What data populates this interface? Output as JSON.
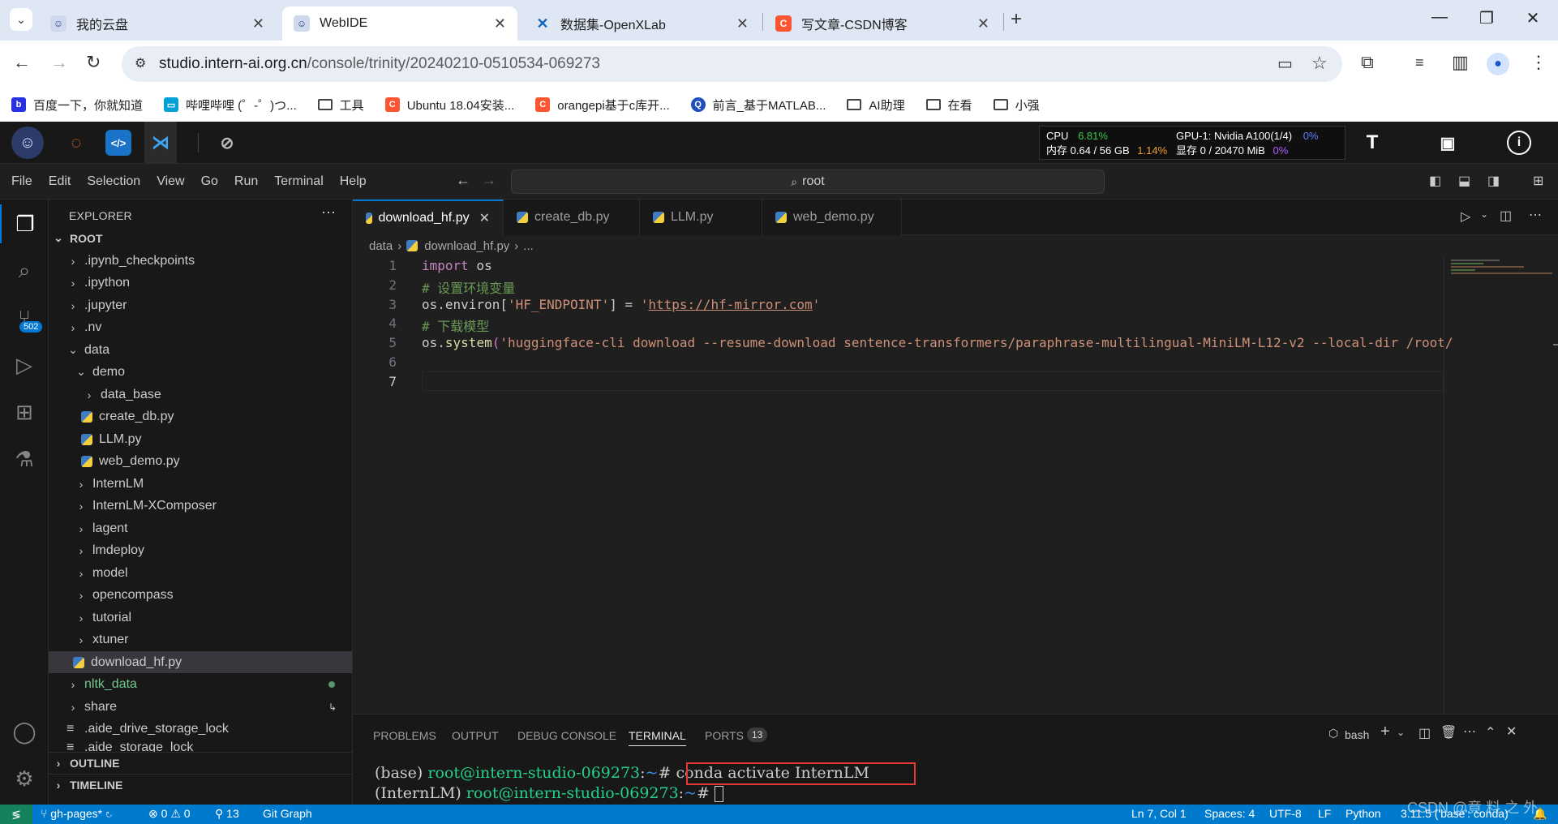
{
  "browser": {
    "tabs": [
      {
        "title": "我的云盘",
        "active": false
      },
      {
        "title": "WebIDE",
        "active": true
      },
      {
        "title": "数据集-OpenXLab",
        "active": false
      },
      {
        "title": "写文章-CSDN博客",
        "active": false
      }
    ],
    "url_host": "studio.intern-ai.org.cn",
    "url_path": "/console/trinity/20240210-0510534-069273",
    "bookmarks": [
      "百度一下，你就知道",
      "哔哩哔哩 (゜-゜)つ...",
      "工具",
      "Ubuntu 18.04安装...",
      "orangepi基于c库开...",
      "前言_基于MATLAB...",
      "AI助理",
      "在看",
      "小强"
    ]
  },
  "studio": {
    "cpu_label": "CPU",
    "cpu_value": "6.81%",
    "mem_label": "内存",
    "mem_value": "0.64 / 56 GB",
    "mem_percent": "1.14%",
    "gpu_label": "GPU-1: Nvidia A100(1/4)",
    "gpu_percent": "0%",
    "vram_label": "显存",
    "vram_value": "0 / 20470 MiB",
    "vram_percent": "0%"
  },
  "menu": [
    "File",
    "Edit",
    "Selection",
    "View",
    "Go",
    "Run",
    "Terminal",
    "Help"
  ],
  "command_center": "root",
  "scm_badge": "502",
  "explorer": {
    "header": "EXPLORER",
    "root": "ROOT",
    "items": [
      ".ipynb_checkpoints",
      ".ipython",
      ".jupyter",
      ".nv",
      "data",
      "demo",
      "data_base",
      "create_db.py",
      "LLM.py",
      "web_demo.py",
      "InternLM",
      "InternLM-XComposer",
      "lagent",
      "lmdeploy",
      "model",
      "opencompass",
      "tutorial",
      "xtuner",
      "download_hf.py",
      "nltk_data",
      "share",
      ".aide_drive_storage_lock",
      ".aide_storage_lock"
    ],
    "outline": "OUTLINE",
    "timeline": "TIMELINE"
  },
  "editor": {
    "tabs": [
      "download_hf.py",
      "create_db.py",
      "LLM.py",
      "web_demo.py"
    ],
    "breadcrumb": [
      "data",
      "download_hf.py",
      "..."
    ],
    "line_numbers": [
      "1",
      "2",
      "3",
      "4",
      "5",
      "6",
      "7"
    ],
    "code": {
      "l1_kw": "import",
      "l1_rest": " os",
      "l2": "# 设置环境变量",
      "l3_a": "os.environ[",
      "l3_key": "'HF_ENDPOINT'",
      "l3_b": "] = ",
      "l3_q1": "'",
      "l3_url": "https://hf-mirror.com",
      "l3_q2": "'",
      "l4": "# 下载模型",
      "l5_a": "os.",
      "l5_fn": "system",
      "l5_p": "(",
      "l5_str": "'huggingface-cli download --resume-download sentence-transformers/paraphrase-multilingual-MiniLM-L12-v2 --local-dir /root/"
    }
  },
  "panel": {
    "tabs": [
      "PROBLEMS",
      "OUTPUT",
      "DEBUG CONSOLE",
      "TERMINAL",
      "PORTS"
    ],
    "ports_count": "13",
    "shell": "bash",
    "term_l1_env": "(base) ",
    "term_l1_user": "root@intern-studio-069273",
    "term_l1_colon": ":",
    "term_l1_path": "~",
    "term_l1_hash": "# ",
    "term_l1_cmd": "conda activate InternLM",
    "term_l2_env": "(InternLM) ",
    "term_l2_user": "root@intern-studio-069273",
    "term_l2_colon": ":",
    "term_l2_path": "~",
    "term_l2_hash": "# "
  },
  "status": {
    "branch": "gh-pages*",
    "errors": "0",
    "warnings": "0",
    "ports": "13",
    "git_graph": "Git Graph",
    "position": "Ln 7, Col 1",
    "spaces": "Spaces: 4",
    "encoding": "UTF-8",
    "eol": "LF",
    "language": "Python",
    "interpreter": "3.11.5 ('base': conda)"
  },
  "watermark": "CSDN @竟 料 之 外",
  "colors": {
    "accent": "#0078d4",
    "status_bar": "#007acc",
    "highlight_box": "#e53935"
  }
}
